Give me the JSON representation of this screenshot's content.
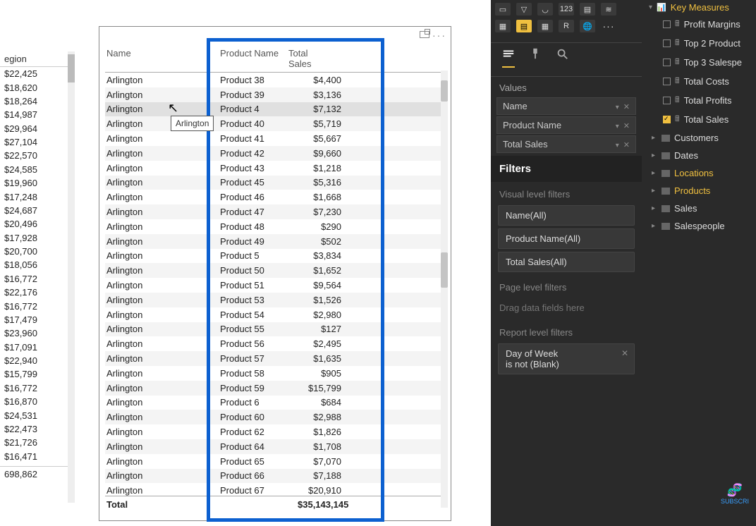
{
  "left_column": {
    "header": "egion",
    "values": [
      "$22,425",
      "$18,620",
      "$18,264",
      "$14,987",
      "$29,964",
      "$27,104",
      "$22,570",
      "$24,585",
      "$19,960",
      "$17,248",
      "$24,687",
      "$20,496",
      "$17,928",
      "$20,700",
      "$18,056",
      "$16,772",
      "$22,176",
      "$16,772",
      "$17,479",
      "$23,960",
      "$17,091",
      "$22,940",
      "$15,799",
      "$16,772",
      "$16,870",
      "$24,531",
      "$22,473",
      "$21,726",
      "$16,471"
    ],
    "total": "698,862"
  },
  "card": {
    "col_headers": {
      "name": "Name",
      "product": "Product Name",
      "sales": "Total Sales"
    },
    "rows": [
      {
        "name": "Arlington",
        "product": "Product 38",
        "sales": "$4,400"
      },
      {
        "name": "Arlington",
        "product": "Product 39",
        "sales": "$3,136"
      },
      {
        "name": "Arlington",
        "product": "Product 4",
        "sales": "$7,132",
        "highlight": true
      },
      {
        "name": "Arlington",
        "product": "Product 40",
        "sales": "$5,719"
      },
      {
        "name": "Arlington",
        "product": "Product 41",
        "sales": "$5,667"
      },
      {
        "name": "Arlington",
        "product": "Product 42",
        "sales": "$9,660"
      },
      {
        "name": "Arlington",
        "product": "Product 43",
        "sales": "$1,218"
      },
      {
        "name": "Arlington",
        "product": "Product 45",
        "sales": "$5,316"
      },
      {
        "name": "Arlington",
        "product": "Product 46",
        "sales": "$1,668"
      },
      {
        "name": "Arlington",
        "product": "Product 47",
        "sales": "$7,230"
      },
      {
        "name": "Arlington",
        "product": "Product 48",
        "sales": "$290"
      },
      {
        "name": "Arlington",
        "product": "Product 49",
        "sales": "$502"
      },
      {
        "name": "Arlington",
        "product": "Product 5",
        "sales": "$3,834"
      },
      {
        "name": "Arlington",
        "product": "Product 50",
        "sales": "$1,652"
      },
      {
        "name": "Arlington",
        "product": "Product 51",
        "sales": "$9,564"
      },
      {
        "name": "Arlington",
        "product": "Product 53",
        "sales": "$1,526"
      },
      {
        "name": "Arlington",
        "product": "Product 54",
        "sales": "$2,980"
      },
      {
        "name": "Arlington",
        "product": "Product 55",
        "sales": "$127"
      },
      {
        "name": "Arlington",
        "product": "Product 56",
        "sales": "$2,495"
      },
      {
        "name": "Arlington",
        "product": "Product 57",
        "sales": "$1,635"
      },
      {
        "name": "Arlington",
        "product": "Product 58",
        "sales": "$905"
      },
      {
        "name": "Arlington",
        "product": "Product 59",
        "sales": "$15,799"
      },
      {
        "name": "Arlington",
        "product": "Product 6",
        "sales": "$684"
      },
      {
        "name": "Arlington",
        "product": "Product 60",
        "sales": "$2,988"
      },
      {
        "name": "Arlington",
        "product": "Product 62",
        "sales": "$1,826"
      },
      {
        "name": "Arlington",
        "product": "Product 64",
        "sales": "$1,708"
      },
      {
        "name": "Arlington",
        "product": "Product 65",
        "sales": "$7,070"
      },
      {
        "name": "Arlington",
        "product": "Product 66",
        "sales": "$7,188"
      },
      {
        "name": "Arlington",
        "product": "Product 67",
        "sales": "$20,910"
      }
    ],
    "total_label": "Total",
    "total_value": "$35,143,145"
  },
  "tooltip": "Arlington",
  "viz": {
    "values_label": "Values",
    "wells": [
      "Name",
      "Product Name",
      "Total Sales"
    ],
    "filters_label": "Filters",
    "visual_level_label": "Visual level filters",
    "visual_filters": [
      "Name(All)",
      "Product Name(All)",
      "Total Sales(All)"
    ],
    "page_level_label": "Page level filters",
    "drag_hint": "Drag data fields here",
    "report_level_label": "Report level filters",
    "report_filter_line1": "Day of Week",
    "report_filter_line2": "is not (Blank)"
  },
  "fields": {
    "key_measures_label": "Key Measures",
    "measures": [
      {
        "label": "Profit Margins",
        "checked": false
      },
      {
        "label": "Top 2 Product",
        "checked": false
      },
      {
        "label": "Top 3 Salespe",
        "checked": false
      },
      {
        "label": "Total Costs",
        "checked": false
      },
      {
        "label": "Total Profits",
        "checked": false
      },
      {
        "label": "Total Sales",
        "checked": true
      }
    ],
    "tables": [
      {
        "label": "Customers",
        "hl": false
      },
      {
        "label": "Dates",
        "hl": false
      },
      {
        "label": "Locations",
        "hl": true
      },
      {
        "label": "Products",
        "hl": true
      },
      {
        "label": "Sales",
        "hl": false
      },
      {
        "label": "Salespeople",
        "hl": false
      }
    ]
  },
  "logo_text": "SUBSCRI"
}
